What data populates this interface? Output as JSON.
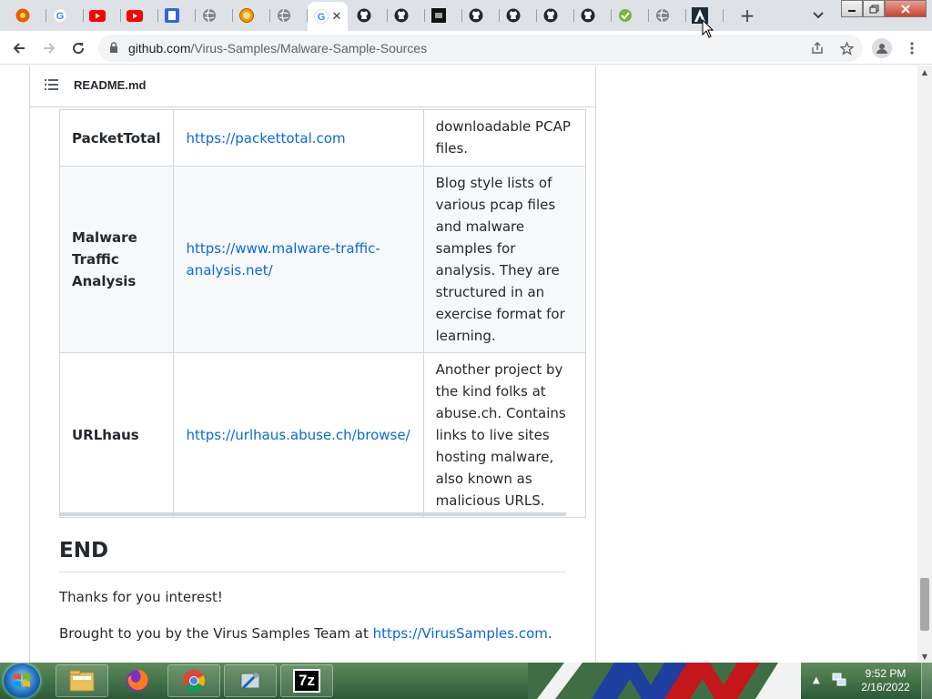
{
  "browser": {
    "tabs": [
      {
        "icon": "firefox-like-icon",
        "color": "#e66000"
      },
      {
        "icon": "google-icon",
        "color": "#4285f4"
      },
      {
        "icon": "youtube-icon",
        "color": "#ff0000"
      },
      {
        "icon": "youtube-icon",
        "color": "#ff0000"
      },
      {
        "icon": "bookmark-app-icon",
        "color": "#3367d6"
      },
      {
        "icon": "globe-icon",
        "color": "#5f6368"
      },
      {
        "icon": "badge-icon",
        "color": "#f29900"
      },
      {
        "icon": "globe-icon",
        "color": "#5f6368"
      },
      {
        "icon": "google-icon",
        "color": "#4285f4",
        "active": true
      },
      {
        "icon": "github-icon",
        "color": "#24292f"
      },
      {
        "icon": "github-icon",
        "color": "#24292f"
      },
      {
        "icon": "dark-app-icon",
        "color": "#111111"
      },
      {
        "icon": "github-icon",
        "color": "#24292f"
      },
      {
        "icon": "github-icon",
        "color": "#24292f"
      },
      {
        "icon": "github-icon",
        "color": "#24292f"
      },
      {
        "icon": "github-icon",
        "color": "#24292f"
      },
      {
        "icon": "green-app-icon",
        "color": "#7cb342"
      },
      {
        "icon": "globe-icon",
        "color": "#5f6368"
      },
      {
        "icon": "arch-logo-icon",
        "color": "#0b6e99"
      }
    ],
    "active_tab_letter": "G",
    "address": {
      "host": "github.com",
      "path": "/Virus-Samples/Malware-Sample-Sources"
    }
  },
  "readme": {
    "title": "README.md",
    "rows": [
      {
        "name": "PacketTotal",
        "link": "https://packettotal.com",
        "desc": "downloadable PCAP files."
      },
      {
        "name": "Malware Traffic Analysis",
        "link": "https://www.malware-traffic-analysis.net/",
        "desc": "Blog style lists of various pcap files and malware samples for analysis. They are structured in an exercise format for learning."
      },
      {
        "name": "URLhaus",
        "link": "https://urlhaus.abuse.ch/browse/",
        "desc": "Another project by the kind folks at abuse.ch. Contains links to live sites hosting malware, also known as malicious URLS."
      }
    ],
    "end_heading": "END",
    "thanks": "Thanks for you interest!",
    "brought_prefix": "Brought to you by the Virus Samples Team at ",
    "brought_link": "https://VirusSamples.com",
    "brought_suffix": "."
  },
  "taskbar": {
    "time": "9:52 PM",
    "date": "2/16/2022",
    "sevenzip_label": "7z"
  }
}
